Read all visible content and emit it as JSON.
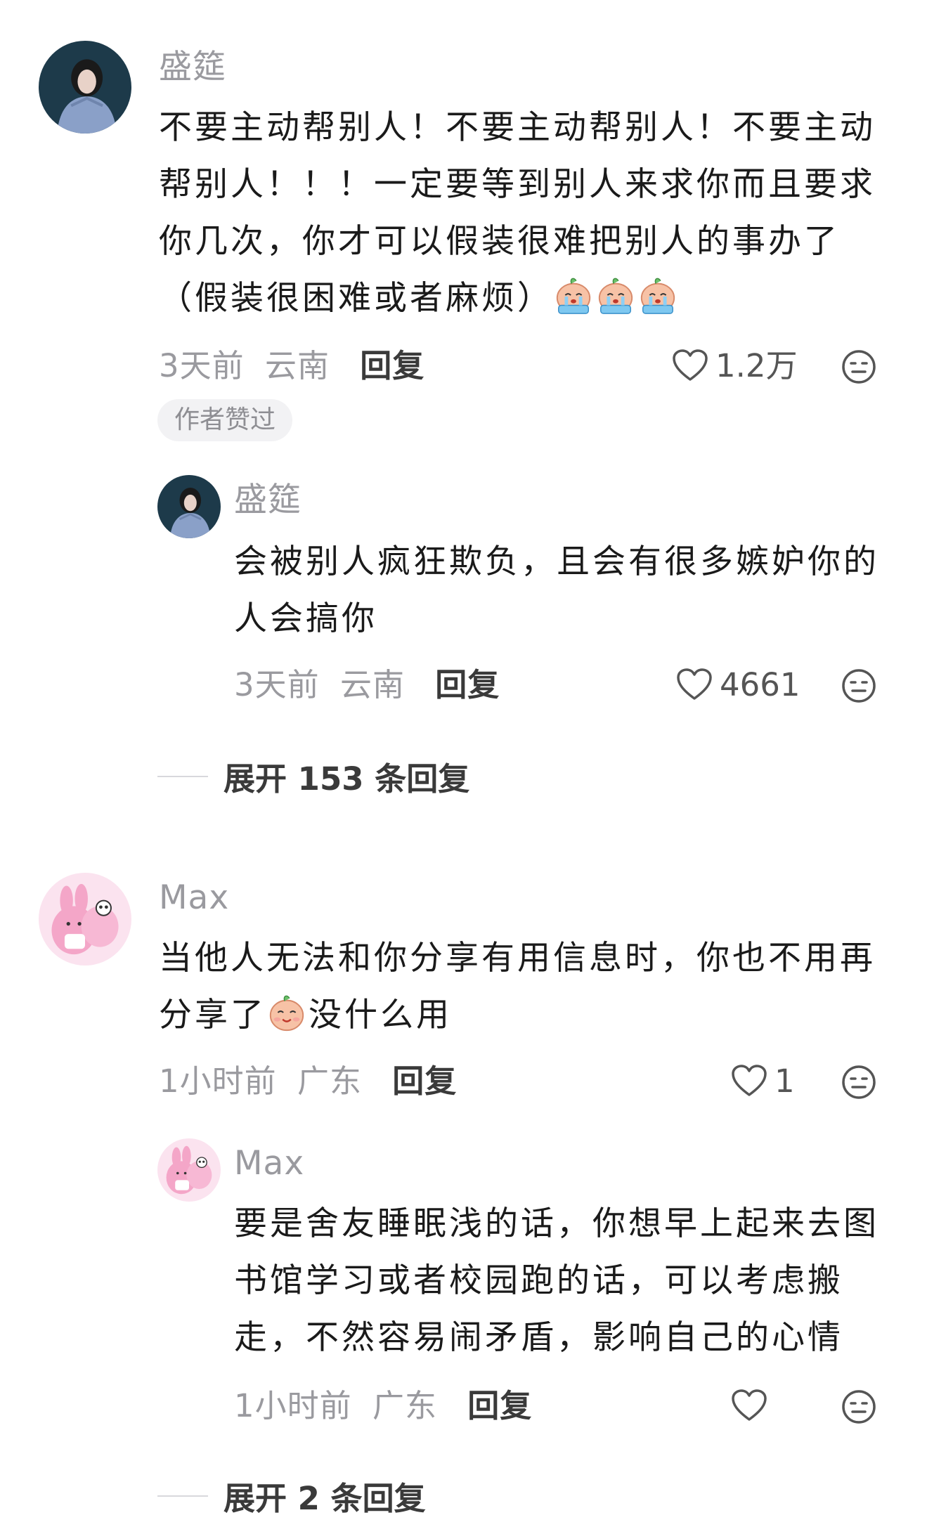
{
  "comments": [
    {
      "username": "盛筵",
      "lines": [
        "不要主动帮别人！不要主动帮别人！不要主动",
        "帮别人！！！一定要等到别人来求你而且要求",
        "你几次，你才可以假装很难把别人的事办了",
        "（假装很困难或者麻烦）"
      ],
      "time": "3天前",
      "location": "云南",
      "reply_label": "回复",
      "likes": "1.2万",
      "badge": "作者赞过",
      "emoji": "crying-face-emoji",
      "reply": {
        "username": "盛筵",
        "lines": [
          "会被别人疯狂欺负，且会有很多嫉妒你的",
          "人会搞你"
        ],
        "time": "3天前",
        "location": "云南",
        "reply_label": "回复",
        "likes": "4661"
      },
      "expand_label": "展开 153 条回复"
    },
    {
      "username": "Max",
      "lines": [
        "当他人无法和你分享有用信息时，你也不用再",
        "分享了",
        "没什么用"
      ],
      "time": "1小时前",
      "location": "广东",
      "reply_label": "回复",
      "likes": "1",
      "emoji": "smiling-face-emoji",
      "reply": {
        "username": "Max",
        "lines": [
          "要是舍友睡眠浅的话，你想早上起来去图",
          "书馆学习或者校园跑的话，可以考虑搬",
          "走，不然容易闹矛盾，影响自己的心情"
        ],
        "time": "1小时前",
        "location": "广东",
        "reply_label": "回复",
        "likes": ""
      },
      "expand_label": "展开 2 条回复"
    }
  ],
  "icons": {
    "like": "heart-outline-icon",
    "dislike": "neutral-face-icon"
  },
  "colors": {
    "username": "#9a9a9f",
    "text": "#1a1a1a",
    "badge_bg": "#f2f2f4",
    "avatar_dark": "#1d3a4a",
    "avatar_pink": "#f6c6dc"
  }
}
